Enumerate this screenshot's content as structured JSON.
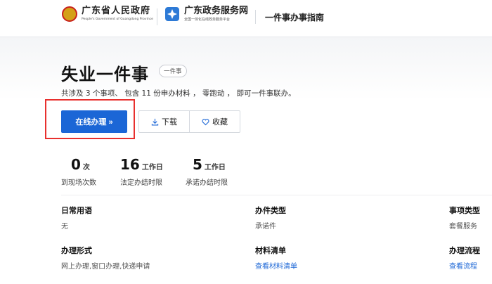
{
  "header": {
    "gov_name": "广东省人民政府",
    "gov_english": "People's Government of Guangdong Province",
    "service_name": "广东政务服务网",
    "service_subtitle": "全国一体化在线政务服务平台",
    "guide_title": "一件事办事指南"
  },
  "page": {
    "title": "失业一件事",
    "tag": "一件事",
    "summary": "共涉及 3 个事项、 包含 11 份申办材料 ， 零跑动 ， 即可一件事联办。"
  },
  "actions": {
    "primary": "在线办理 »",
    "download": "下载",
    "favorite": "收藏"
  },
  "stats": [
    {
      "value": "0",
      "unit": "次",
      "label": "到现场次数"
    },
    {
      "value": "16",
      "unit": "工作日",
      "label": "法定办结时限"
    },
    {
      "value": "5",
      "unit": "工作日",
      "label": "承诺办结时限"
    }
  ],
  "info": {
    "daily_term": {
      "label": "日常用语",
      "value": "无"
    },
    "case_type": {
      "label": "办件类型",
      "value": "承诺件"
    },
    "item_type": {
      "label": "事项类型",
      "value": "套餐服务"
    },
    "handle_form": {
      "label": "办理形式",
      "value": "网上办理,窗口办理,快递申请"
    },
    "materials": {
      "label": "材料清单",
      "link": "查看材料清单"
    },
    "process": {
      "label": "办理流程",
      "link": "查看流程"
    }
  },
  "colors": {
    "primary": "#1b66d6",
    "highlight": "#e8302e"
  }
}
